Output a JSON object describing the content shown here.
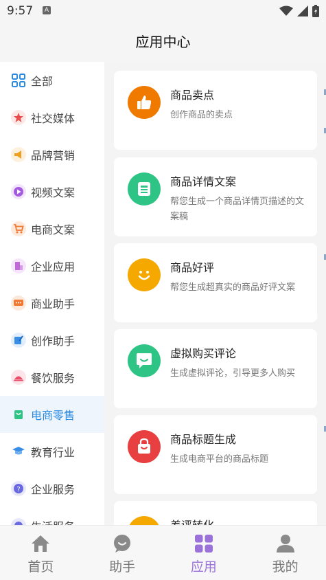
{
  "status": {
    "time": "9:57",
    "notif": "A"
  },
  "header": {
    "title": "应用中心"
  },
  "sidebar": {
    "items": [
      {
        "label": "全部",
        "icon": "grid-icon",
        "color": "#2a8ae0"
      },
      {
        "label": "社交媒体",
        "icon": "star-icon",
        "color": "#e84e4e"
      },
      {
        "label": "品牌营销",
        "icon": "megaphone-icon",
        "color": "#f0a020"
      },
      {
        "label": "视频文案",
        "icon": "play-icon",
        "color": "#a35be0"
      },
      {
        "label": "电商文案",
        "icon": "cart-icon",
        "color": "#f07830"
      },
      {
        "label": "企业应用",
        "icon": "building-icon",
        "color": "#c06ad8"
      },
      {
        "label": "商业助手",
        "icon": "chat-icon",
        "color": "#f07830"
      },
      {
        "label": "创作助手",
        "icon": "pen-icon",
        "color": "#3a8ee6"
      },
      {
        "label": "餐饮服务",
        "icon": "dish-icon",
        "color": "#e84e6a"
      },
      {
        "label": "电商零售",
        "icon": "bag-icon",
        "color": "#2ec486"
      },
      {
        "label": "教育行业",
        "icon": "cap-icon",
        "color": "#3a8ee6"
      },
      {
        "label": "企业服务",
        "icon": "question-icon",
        "color": "#6a6ae0"
      },
      {
        "label": "生活服务",
        "icon": "life-icon",
        "color": "#6a6ae0"
      }
    ],
    "active_index": 9
  },
  "cards": [
    {
      "title": "商品卖点",
      "desc": "创作商品的卖点",
      "icon": "thumbs-up-icon",
      "color": "#f07a00"
    },
    {
      "title": "商品详情文案",
      "desc": "帮您生成一个商品详情页描述的文案稿",
      "icon": "document-icon",
      "color": "#2ec486"
    },
    {
      "title": "商品好评",
      "desc": "帮您生成超真实的商品好评文案",
      "icon": "smile-icon",
      "color": "#f5a800"
    },
    {
      "title": "虚拟购买评论",
      "desc": "生成虚拟评论，引导更多人购买",
      "icon": "chat-bubble-icon",
      "color": "#2ec486"
    },
    {
      "title": "商品标题生成",
      "desc": "生成电商平台的商品标题",
      "icon": "shopping-bag-icon",
      "color": "#e84040"
    },
    {
      "title": "差评转化",
      "desc": "",
      "icon": "partial-icon",
      "color": "#f5a800"
    }
  ],
  "tabbar": {
    "tabs": [
      {
        "label": "首页",
        "icon": "home-icon"
      },
      {
        "label": "助手",
        "icon": "assistant-icon"
      },
      {
        "label": "应用",
        "icon": "apps-icon"
      },
      {
        "label": "我的",
        "icon": "profile-icon"
      }
    ],
    "active_color": "#9b72d9",
    "inactive_color": "#777777"
  }
}
